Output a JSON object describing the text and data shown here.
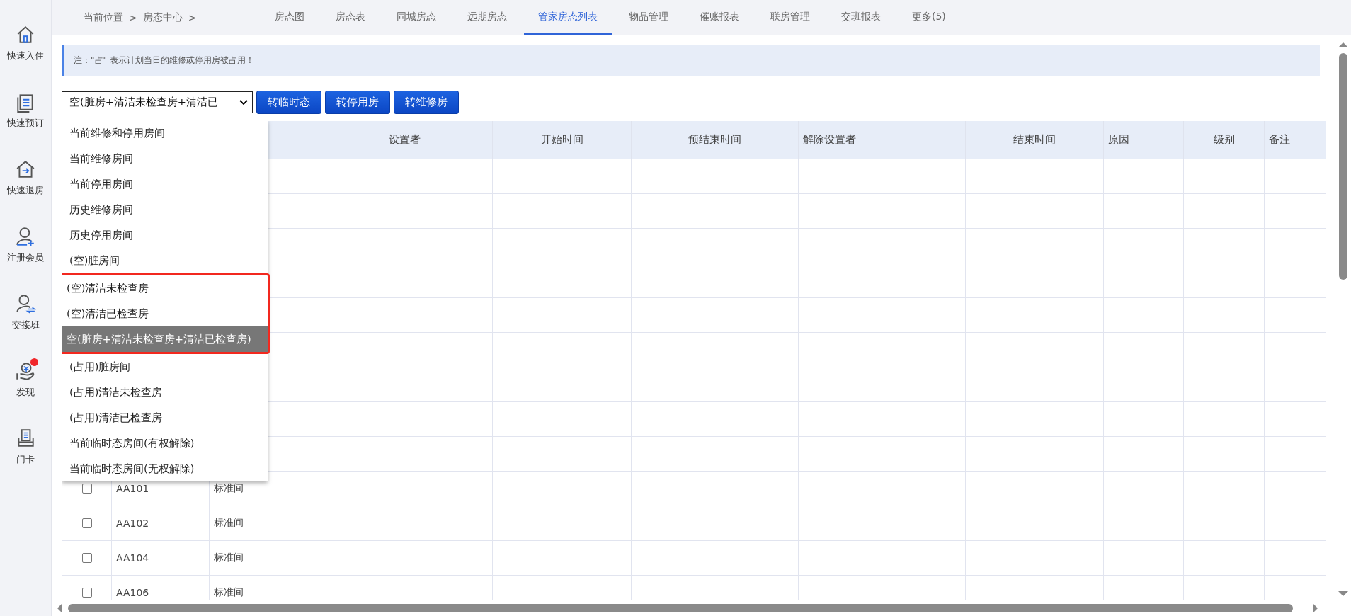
{
  "sidebar": {
    "items": [
      {
        "label": "快速入住",
        "badge": false
      },
      {
        "label": "快速预订",
        "badge": false
      },
      {
        "label": "快速退房",
        "badge": false
      },
      {
        "label": "注册会员",
        "badge": false
      },
      {
        "label": "交接班",
        "badge": false
      },
      {
        "label": "发现",
        "badge": true
      },
      {
        "label": "门卡",
        "badge": false
      }
    ]
  },
  "breadcrumb": [
    "当前位置",
    ">",
    "房态中心",
    ">"
  ],
  "tabs": [
    {
      "label": "房态图",
      "selected": false
    },
    {
      "label": "房态表",
      "selected": false
    },
    {
      "label": "同城房态",
      "selected": false
    },
    {
      "label": "远期房态",
      "selected": false
    },
    {
      "label": "管家房态列表",
      "selected": true
    },
    {
      "label": "物品管理",
      "selected": false
    },
    {
      "label": "催账报表",
      "selected": false
    },
    {
      "label": "联房管理",
      "selected": false
    },
    {
      "label": "交班报表",
      "selected": false
    },
    {
      "label": "更多(5)",
      "selected": false
    }
  ],
  "notice": "注：\"占\" 表示计划当日的维修或停用房被占用！",
  "filter": {
    "value": "空(脏房+清洁未检查房+清洁已",
    "expanded": true,
    "options": [
      {
        "label": "当前维修和停用房间",
        "selected": false,
        "highlighted": false
      },
      {
        "label": "当前维修房间",
        "selected": false,
        "highlighted": false
      },
      {
        "label": "当前停用房间",
        "selected": false,
        "highlighted": false
      },
      {
        "label": "历史维修房间",
        "selected": false,
        "highlighted": false
      },
      {
        "label": "历史停用房间",
        "selected": false,
        "highlighted": false
      },
      {
        "label": "(空)脏房间",
        "selected": false,
        "highlighted": false
      },
      {
        "label": "(空)清洁未检查房",
        "selected": false,
        "highlighted": true
      },
      {
        "label": "(空)清洁已检查房",
        "selected": false,
        "highlighted": true
      },
      {
        "label": "空(脏房+清洁未检查房+清洁已检查房)",
        "selected": true,
        "highlighted": true
      },
      {
        "label": "(占用)脏房间",
        "selected": false,
        "highlighted": false
      },
      {
        "label": "(占用)清洁未检查房",
        "selected": false,
        "highlighted": false
      },
      {
        "label": "(占用)清洁已检查房",
        "selected": false,
        "highlighted": false
      },
      {
        "label": "当前临时态房间(有权解除)",
        "selected": false,
        "highlighted": false
      },
      {
        "label": "当前临时态房间(无权解除)",
        "selected": false,
        "highlighted": false
      }
    ]
  },
  "buttons": [
    "转临时态",
    "转停用房",
    "转维修房"
  ],
  "table": {
    "columns": [
      "设置者",
      "开始时间",
      "预结束时间",
      "解除设置者",
      "结束时间",
      "原因",
      "级别",
      "备注"
    ],
    "rows": [
      {
        "checked": false,
        "room": "AA101",
        "type": "标准间"
      },
      {
        "checked": false,
        "room": "AA102",
        "type": "标准间"
      },
      {
        "checked": false,
        "room": "AA104",
        "type": "标准间"
      },
      {
        "checked": false,
        "room": "AA106",
        "type": "标准间"
      }
    ]
  }
}
